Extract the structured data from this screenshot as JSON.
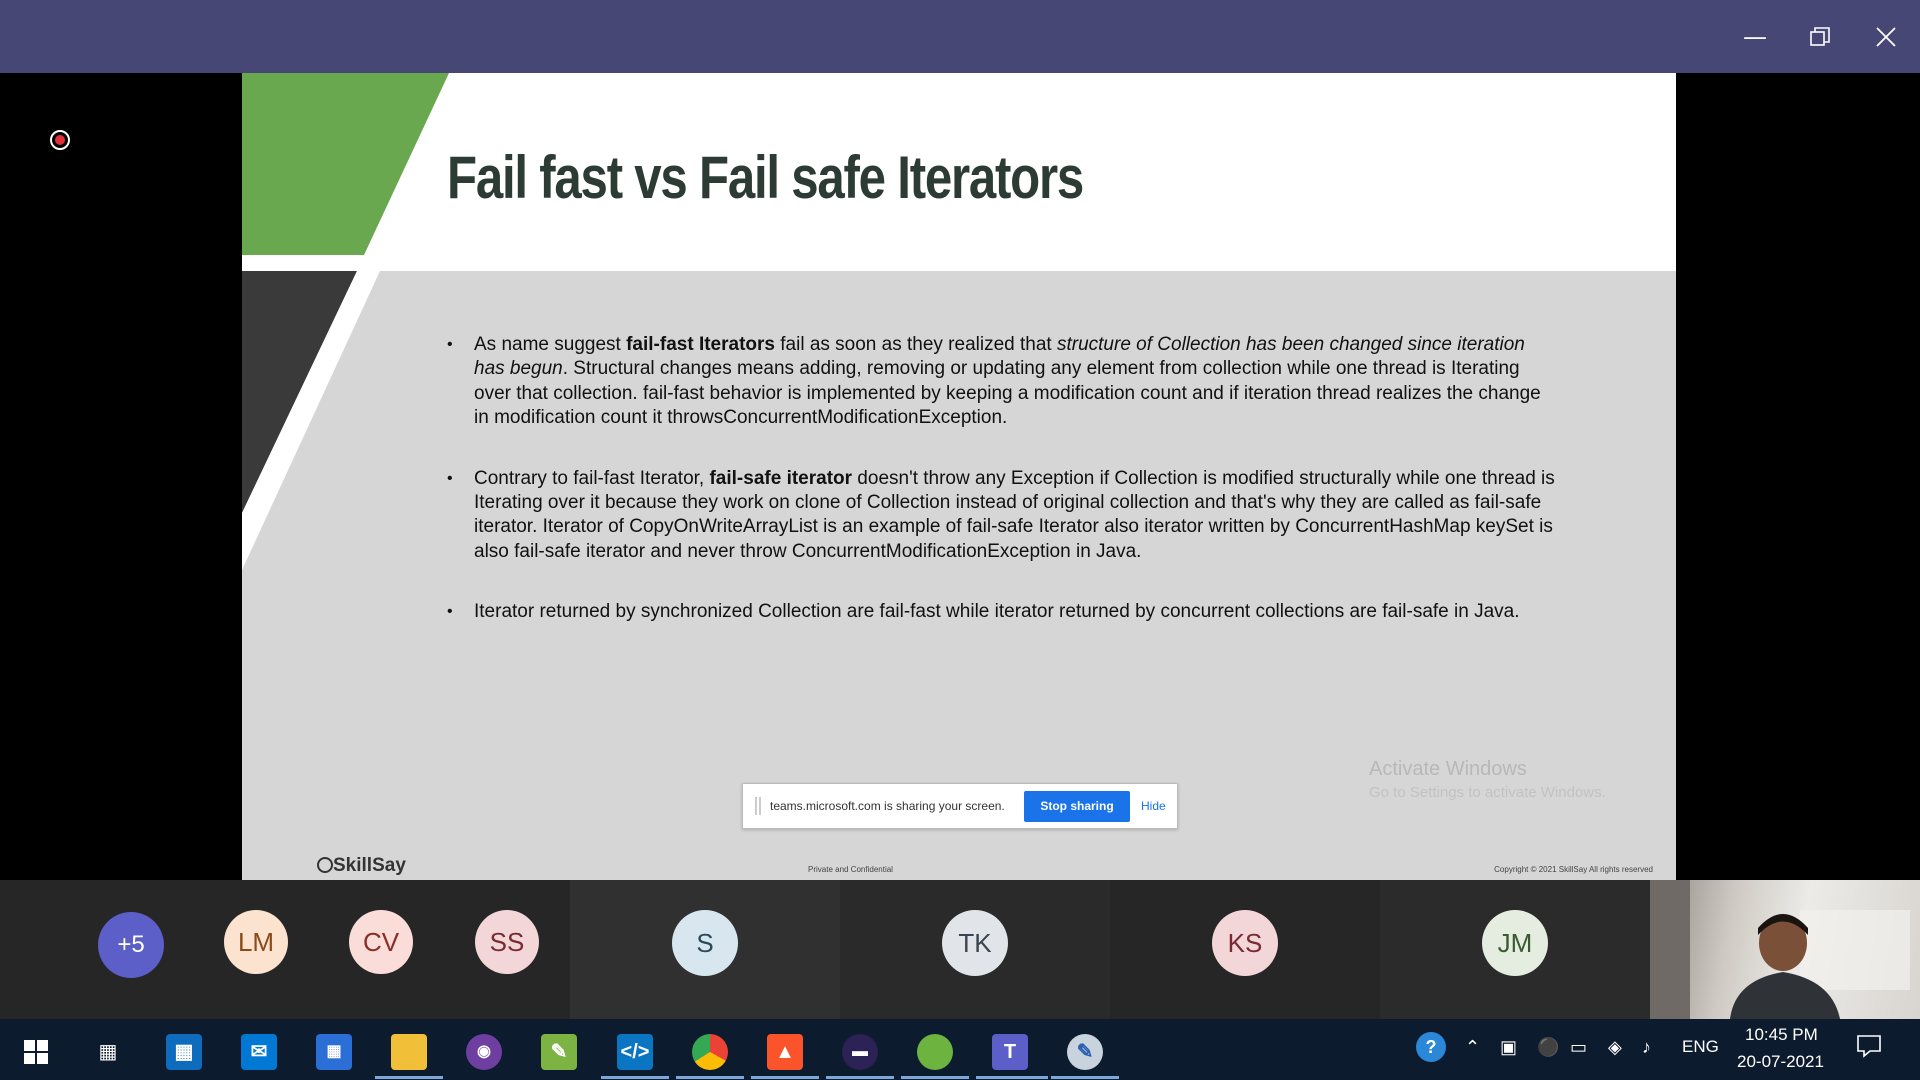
{
  "window": {
    "minimize_icon": "minimize-icon",
    "maximize_icon": "restore-icon",
    "close_icon": "close-icon",
    "titlebar_color": "#464775"
  },
  "slide": {
    "title": "Fail fast vs Fail safe Iterators",
    "bullets": [
      {
        "p1": "As name suggest ",
        "b1": "fail-fast Iterators",
        "p2": " fail as soon as they realized that ",
        "i1": "structure of Collection has been changed since iteration has begun",
        "p3": ". Structural changes means adding, removing or updating any element from collection while one thread is Iterating over that collection. fail-fast behavior is implemented by keeping a modification count and if iteration thread realizes the change in modification count it throwsConcurrentModificationException."
      },
      {
        "p1": "Contrary to fail-fast Iterator, ",
        "b1": "fail-safe iterator",
        "p2": " doesn't throw any Exception if Collection is modified structurally while one thread is Iterating over it because they work on clone of Collection instead of original collection and that's why they are called as fail-safe iterator. Iterator of CopyOnWriteArrayList is an example of fail-safe Iterator also iterator written by ConcurrentHashMap keySet is also fail-safe iterator and never throw ConcurrentModificationException in Java."
      },
      {
        "p1": "Iterator returned by synchronized Collection are fail-fast while iterator returned by concurrent collections are fail-safe in Java."
      }
    ],
    "footer_logo": "SkillSay",
    "footer_mid": "Private and Confidential",
    "footer_right": "Copyright © 2021 SkillSay All rights reserved",
    "accent_green": "#6aa84f",
    "accent_dark": "#3a3a3a"
  },
  "watermark": {
    "line1": "Activate Windows",
    "line2": "Go to Settings to activate Windows."
  },
  "share_bar": {
    "text": "teams.microsoft.com is sharing your screen.",
    "stop_label": "Stop sharing",
    "hide_label": "Hide"
  },
  "participants": [
    {
      "initials": "+5",
      "bg": "#5b5fc7",
      "fg": "#ffffff"
    },
    {
      "initials": "LM",
      "bg": "#fbe3cf",
      "fg": "#8a4a1a"
    },
    {
      "initials": "CV",
      "bg": "#fadcd9",
      "fg": "#8a2f28"
    },
    {
      "initials": "SS",
      "bg": "#f3d6d8",
      "fg": "#7a2a35"
    },
    {
      "initials": "S",
      "bg": "#d8e7ef",
      "fg": "#2a4a5a"
    },
    {
      "initials": "TK",
      "bg": "#e1e5ea",
      "fg": "#3a4450"
    },
    {
      "initials": "KS",
      "bg": "#f3d6d8",
      "fg": "#7a2a35"
    },
    {
      "initials": "JM",
      "bg": "#e4ede0",
      "fg": "#3a5a30"
    }
  ],
  "taskbar": {
    "apps": [
      {
        "name": "start-icon"
      },
      {
        "name": "task-view-icon"
      },
      {
        "name": "store-icon"
      },
      {
        "name": "mail-icon"
      },
      {
        "name": "calendar-icon"
      },
      {
        "name": "file-explorer-icon"
      },
      {
        "name": "github-icon"
      },
      {
        "name": "notepad-icon"
      },
      {
        "name": "vscode-icon"
      },
      {
        "name": "chrome-icon"
      },
      {
        "name": "brave-icon"
      },
      {
        "name": "eclipse-icon"
      },
      {
        "name": "spring-tools-icon"
      },
      {
        "name": "teams-icon"
      },
      {
        "name": "paint-icon"
      }
    ],
    "tray_language": "ENG",
    "time": "10:45 PM",
    "date": "20-07-2021"
  }
}
